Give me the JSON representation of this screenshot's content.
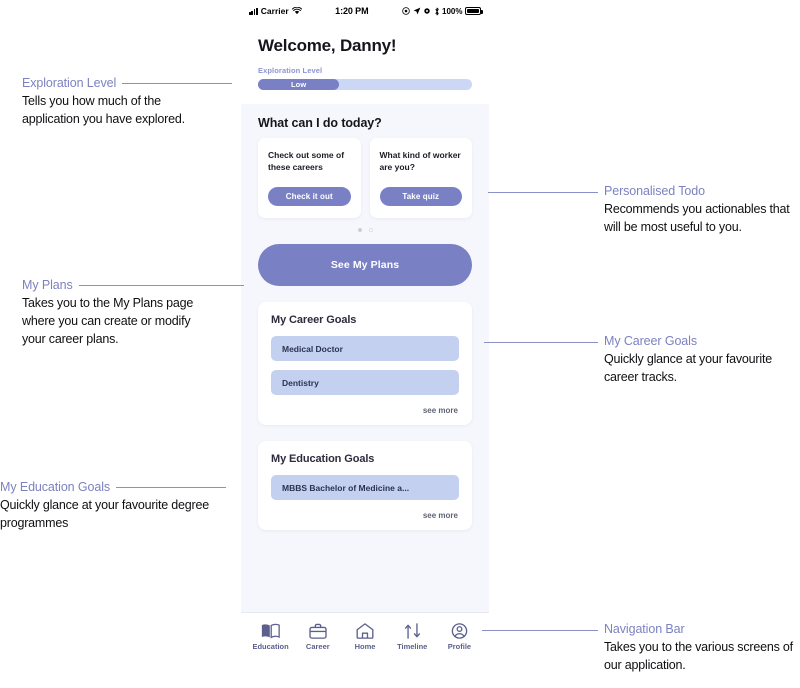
{
  "status_bar": {
    "carrier": "Carrier",
    "time": "1:20 PM",
    "battery_pct": "100%",
    "icons": [
      "signal-icon",
      "wifi-icon",
      "location-icon",
      "navigation-arrow-icon",
      "settings-gear-icon",
      "bluetooth-icon",
      "battery-icon"
    ]
  },
  "app": {
    "welcome_title": "Welcome, Danny!",
    "exploration": {
      "label": "Exploration Level",
      "value_label": "Low",
      "percent": 38
    },
    "today": {
      "section_title": "What can I do today?",
      "cards": [
        {
          "text": "Check out some of these careers",
          "button": "Check it out"
        },
        {
          "text": "What kind of worker are you?",
          "button": "Take quiz"
        }
      ],
      "dots": 2,
      "active_dot": 0
    },
    "plans_button": "See My Plans",
    "career_goals": {
      "title": "My Career Goals",
      "items": [
        "Medical Doctor",
        "Dentistry"
      ],
      "see_more": "see more"
    },
    "education_goals": {
      "title": "My Education Goals",
      "items": [
        "MBBS Bachelor of Medicine a..."
      ],
      "see_more": "see more"
    },
    "nav": [
      {
        "label": "Education",
        "icon": "book-icon"
      },
      {
        "label": "Career",
        "icon": "briefcase-icon"
      },
      {
        "label": "Home",
        "icon": "home-icon"
      },
      {
        "label": "Timeline",
        "icon": "timeline-arrows-icon"
      },
      {
        "label": "Profile",
        "icon": "profile-person-icon"
      }
    ]
  },
  "annotations": {
    "exploration_level": {
      "title": "Exploration Level",
      "body": "Tells you how much of the application you have explored."
    },
    "my_plans": {
      "title": "My Plans",
      "body": "Takes you to the My Plans page where you can create or modify your career plans."
    },
    "my_education_goals": {
      "title": "My Education Goals",
      "body": "Quickly glance at your favourite degree programmes"
    },
    "personalised_todo": {
      "title": "Personalised Todo",
      "body": "Recommends you actionables that will be most useful to you."
    },
    "my_career_goals": {
      "title": "My Career Goals",
      "body": "Quickly glance at your favourite career tracks."
    },
    "navigation_bar": {
      "title": "Navigation Bar",
      "body": "Takes you to the various screens of our application."
    }
  },
  "colors": {
    "accent_purple": "#7a80c4",
    "goal_item_blue": "#c4d0f0",
    "progress_track": "#ccd7f5",
    "phone_bg": "#f6f7fc",
    "annotation_title": "#7c82c0"
  }
}
